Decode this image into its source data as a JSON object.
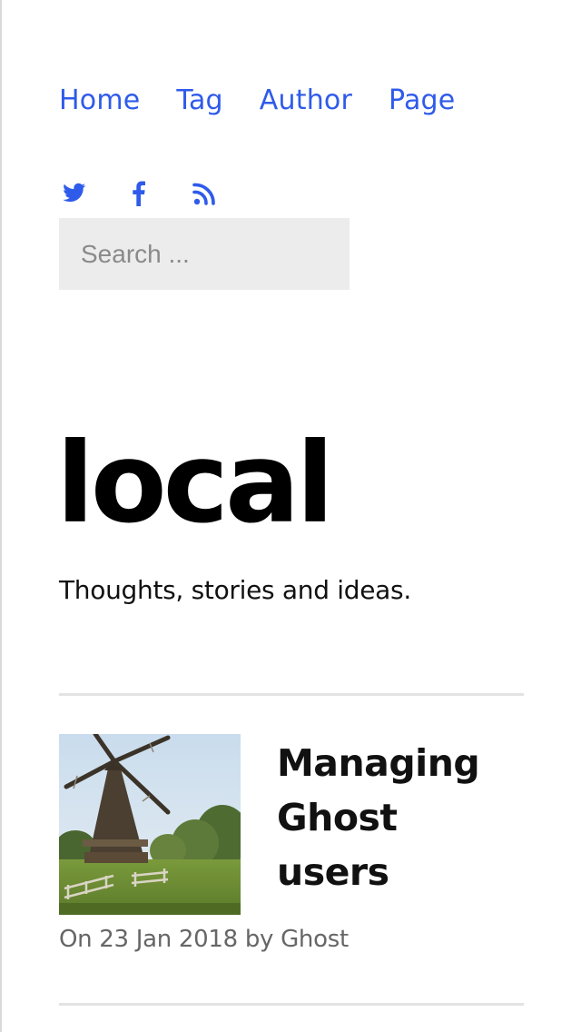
{
  "nav": {
    "items": [
      {
        "label": "Home"
      },
      {
        "label": "Tag"
      },
      {
        "label": "Author"
      },
      {
        "label": "Page"
      }
    ]
  },
  "social": {
    "icons": [
      "twitter-icon",
      "facebook-icon",
      "rss-icon"
    ],
    "color": "#2f5bea"
  },
  "search": {
    "placeholder": "Search ...",
    "value": ""
  },
  "site": {
    "title": "local",
    "description": "Thoughts, stories and ideas."
  },
  "posts": [
    {
      "title_lines": [
        "Managing",
        "Ghost",
        "users"
      ],
      "meta": "On 23 Jan 2018 by Ghost",
      "image": "windmill-photo"
    }
  ],
  "colors": {
    "accent": "#2f5bea",
    "text": "#111111",
    "meta": "#666666",
    "search_bg": "#ececec",
    "rule": "#e3e3e3"
  }
}
